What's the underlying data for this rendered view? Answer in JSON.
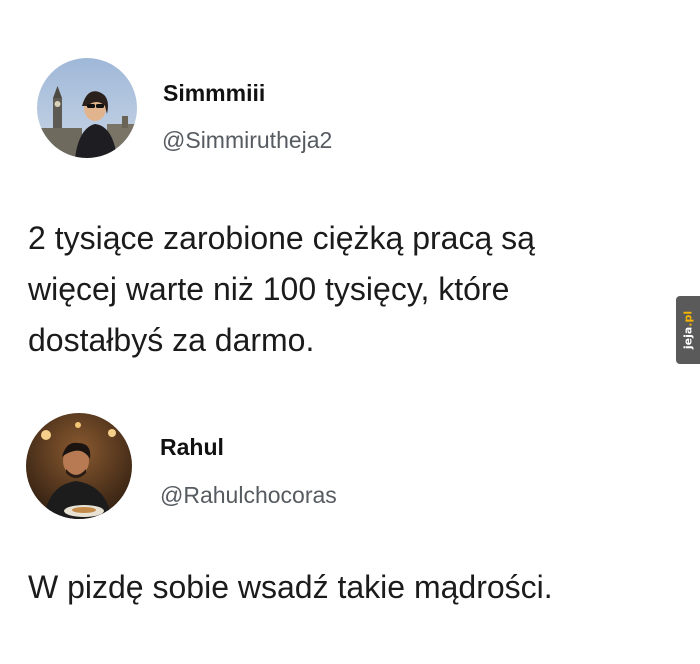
{
  "tweets": [
    {
      "name": "Simmmiii",
      "handle": "@Simmirutheja2",
      "text_lines": [
        "2 tysiące zarobione ciężką pracą są",
        "więcej warte niż 100 tysięcy, które",
        "dostałbyś za darmo."
      ]
    },
    {
      "name": "Rahul",
      "handle": "@Rahulchocoras",
      "text_lines": [
        "W pizdę sobie wsadź takie mądrości."
      ]
    }
  ],
  "watermark": {
    "brand": "jeja",
    "suffix": ".pl"
  }
}
